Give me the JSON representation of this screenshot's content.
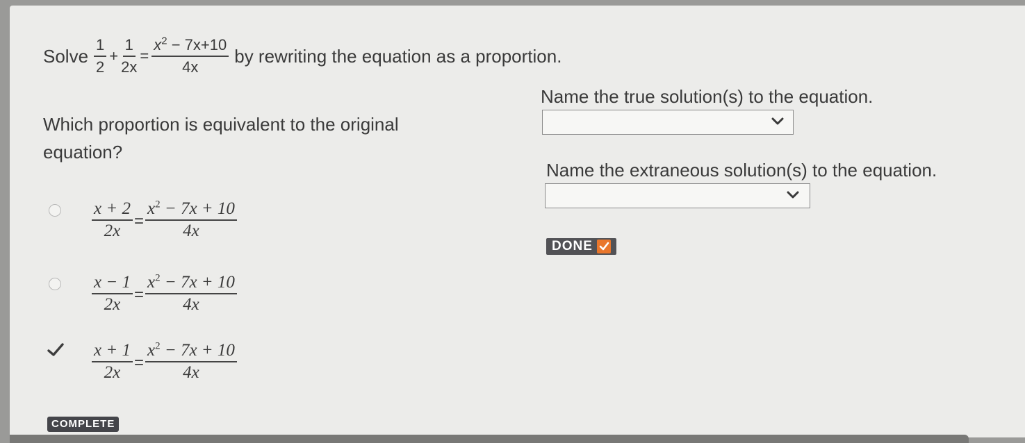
{
  "question": {
    "prefix": "Solve",
    "suffix": "by rewriting the equation as a proportion.",
    "equation": {
      "t1_num": "1",
      "t1_den": "2",
      "plus": "+",
      "t2_num": "1",
      "t2_den": "2x",
      "eq": "=",
      "rhs_num_a": "x",
      "rhs_num_exp": "2",
      "rhs_num_b": " − 7x+10",
      "rhs_den": "4x"
    }
  },
  "part1": {
    "prompt_line1": "Which proportion is equivalent to the original",
    "prompt_line2": "equation?",
    "options": [
      {
        "num": "x + 2",
        "eq": "=",
        "rhs_a": "x",
        "rhs_exp": "2",
        "rhs_b": " − 7x + 10",
        "den_l": "2x",
        "den_r": "4x",
        "selected": false
      },
      {
        "num": "x − 1",
        "eq": "=",
        "rhs_a": "x",
        "rhs_exp": "2",
        "rhs_b": " − 7x + 10",
        "den_l": "2x",
        "den_r": "4x",
        "selected": false
      },
      {
        "num": "x + 1",
        "eq": "=",
        "rhs_a": "x",
        "rhs_exp": "2",
        "rhs_b": " − 7x + 10",
        "den_l": "2x",
        "den_r": "4x",
        "selected": true
      }
    ],
    "status_badge": "COMPLETE"
  },
  "part2": {
    "true_label": "Name the true solution(s) to the equation.",
    "true_value": "",
    "extraneous_label": "Name the extraneous solution(s) to the equation.",
    "extraneous_value": "",
    "done_label": "DONE"
  },
  "colors": {
    "card": "#ececea",
    "done_check": "#e9762b",
    "badge": "#44454a"
  },
  "icons": {
    "dropdown": "chevron-down-icon",
    "selected": "checkmark-icon",
    "done": "check-square-icon"
  }
}
